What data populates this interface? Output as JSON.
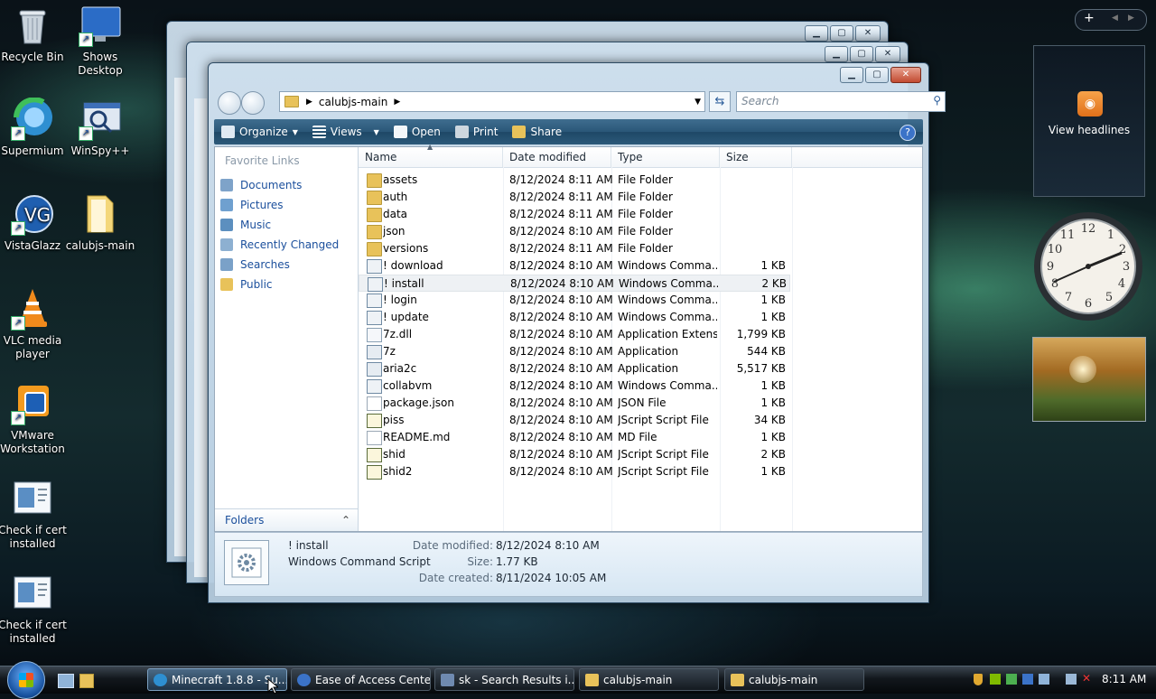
{
  "desktop": {
    "icons": [
      {
        "label": "Recycle Bin",
        "icon": "recycle-bin-icon"
      },
      {
        "label": "Shows Desktop",
        "icon": "show-desktop-icon"
      },
      {
        "label": "Supermium",
        "icon": "supermium-icon"
      },
      {
        "label": "WinSpy++",
        "icon": "winspy-icon"
      },
      {
        "label": "VistaGlazz",
        "icon": "vistaglazz-icon"
      },
      {
        "label": "calubjs-main",
        "icon": "folder-icon"
      },
      {
        "label": "VLC media player",
        "icon": "vlc-icon"
      },
      {
        "label": "VMware Workstation",
        "icon": "vmware-icon"
      },
      {
        "label": "Check if cert installed",
        "icon": "script-icon"
      },
      {
        "label": "Check if cert installed",
        "icon": "script-icon"
      }
    ]
  },
  "explorer": {
    "address": {
      "crumb": "calubjs-main"
    },
    "search_placeholder": "Search",
    "toolbar": {
      "organize": "Organize",
      "views": "Views",
      "open": "Open",
      "print": "Print",
      "share": "Share",
      "help": "?"
    },
    "nav": {
      "favorite_links_title": "Favorite Links",
      "items": [
        "Documents",
        "Pictures",
        "Music",
        "Recently Changed",
        "Searches",
        "Public"
      ],
      "folders_label": "Folders"
    },
    "columns": {
      "name": "Name",
      "date": "Date modified",
      "type": "Type",
      "size": "Size"
    },
    "files": [
      {
        "name": "assets",
        "date": "8/12/2024 8:11 AM",
        "type": "File Folder",
        "size": "",
        "kind": "folder"
      },
      {
        "name": "auth",
        "date": "8/12/2024 8:11 AM",
        "type": "File Folder",
        "size": "",
        "kind": "folder"
      },
      {
        "name": "data",
        "date": "8/12/2024 8:11 AM",
        "type": "File Folder",
        "size": "",
        "kind": "folder"
      },
      {
        "name": "json",
        "date": "8/12/2024 8:10 AM",
        "type": "File Folder",
        "size": "",
        "kind": "folder"
      },
      {
        "name": "versions",
        "date": "8/12/2024 8:11 AM",
        "type": "File Folder",
        "size": "",
        "kind": "folder"
      },
      {
        "name": "! download",
        "date": "8/12/2024 8:10 AM",
        "type": "Windows Comma...",
        "size": "1 KB",
        "kind": "cmd"
      },
      {
        "name": "! install",
        "date": "8/12/2024 8:10 AM",
        "type": "Windows Comma...",
        "size": "2 KB",
        "kind": "cmd"
      },
      {
        "name": "! login",
        "date": "8/12/2024 8:10 AM",
        "type": "Windows Comma...",
        "size": "1 KB",
        "kind": "cmd"
      },
      {
        "name": "! update",
        "date": "8/12/2024 8:10 AM",
        "type": "Windows Comma...",
        "size": "1 KB",
        "kind": "cmd"
      },
      {
        "name": "7z.dll",
        "date": "8/12/2024 8:10 AM",
        "type": "Application Extens...",
        "size": "1,799 KB",
        "kind": "dll"
      },
      {
        "name": "7z",
        "date": "8/12/2024 8:10 AM",
        "type": "Application",
        "size": "544 KB",
        "kind": "app"
      },
      {
        "name": "aria2c",
        "date": "8/12/2024 8:10 AM",
        "type": "Application",
        "size": "5,517 KB",
        "kind": "app"
      },
      {
        "name": "collabvm",
        "date": "8/12/2024 8:10 AM",
        "type": "Windows Comma...",
        "size": "1 KB",
        "kind": "cmd"
      },
      {
        "name": "package.json",
        "date": "8/12/2024 8:10 AM",
        "type": "JSON File",
        "size": "1 KB",
        "kind": "doc"
      },
      {
        "name": "piss",
        "date": "8/12/2024 8:10 AM",
        "type": "JScript Script File",
        "size": "34 KB",
        "kind": "js"
      },
      {
        "name": "README.md",
        "date": "8/12/2024 8:10 AM",
        "type": "MD File",
        "size": "1 KB",
        "kind": "doc"
      },
      {
        "name": "shid",
        "date": "8/12/2024 8:10 AM",
        "type": "JScript Script File",
        "size": "2 KB",
        "kind": "js"
      },
      {
        "name": "shid2",
        "date": "8/12/2024 8:10 AM",
        "type": "JScript Script File",
        "size": "1 KB",
        "kind": "js"
      }
    ],
    "selected_index": 6,
    "details": {
      "name": "! install",
      "type": "Windows Command Script",
      "date_modified_label": "Date modified:",
      "date_modified": "8/12/2024 8:10 AM",
      "size_label": "Size:",
      "size": "1.77 KB",
      "date_created_label": "Date created:",
      "date_created": "8/11/2024 10:05 AM"
    }
  },
  "sidebar_gadgets": {
    "plus": "+",
    "feed_label": "View headlines"
  },
  "taskbar": {
    "buttons": [
      {
        "label": "Minecraft 1.8.8 - Su...",
        "icon": "supermium-icon"
      },
      {
        "label": "Ease of Access Center",
        "icon": "ease-of-access-icon"
      },
      {
        "label": "sk - Search Results i...",
        "icon": "search-results-icon"
      },
      {
        "label": "calubjs-main",
        "icon": "folder-icon"
      },
      {
        "label": "calubjs-main",
        "icon": "folder-icon"
      }
    ],
    "clock": "8:11 AM"
  },
  "colors": {
    "link": "#1b4f9c",
    "toolbar": "#2a5778",
    "folder": "#e8c25a"
  }
}
